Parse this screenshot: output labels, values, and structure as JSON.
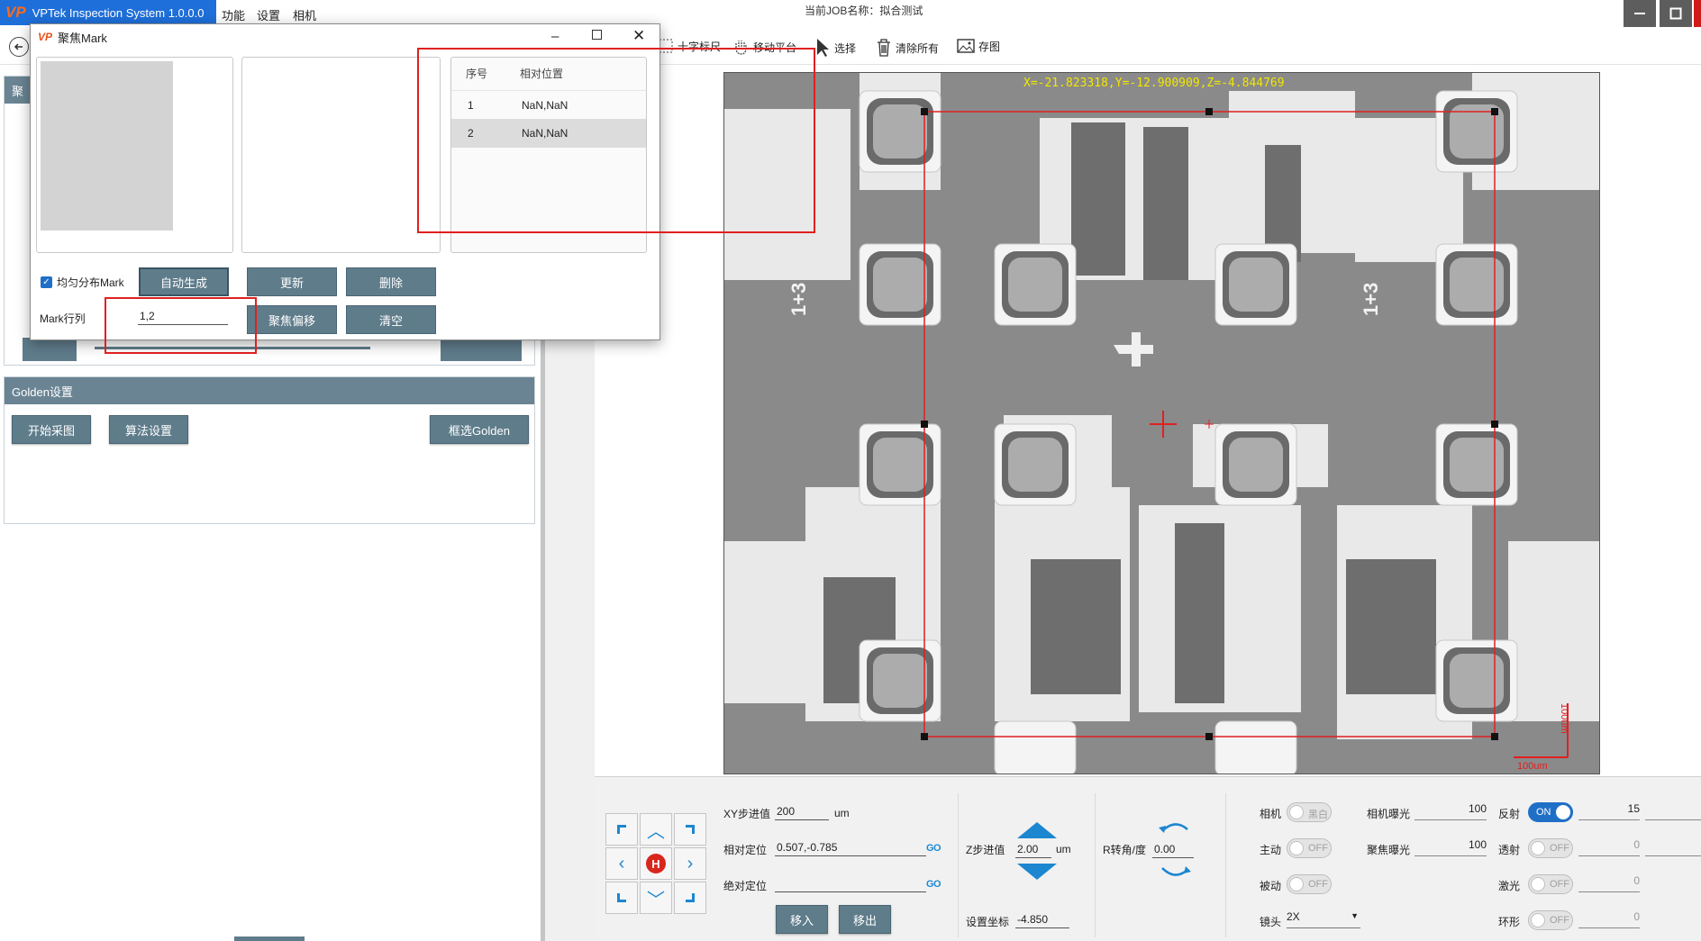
{
  "titlebar": {
    "app_title": "VPTek Inspection System 1.0.0.0",
    "logo": "VP",
    "menus": [
      "功能",
      "设置",
      "相机"
    ],
    "job_label": "当前JOB名称：拟合测试"
  },
  "toolbar": {
    "items": [
      {
        "label": "十字标尺",
        "icon": "crosshair-ruler-icon"
      },
      {
        "label": "移动平台",
        "icon": "hand-move-icon"
      },
      {
        "label": "选择",
        "icon": "cursor-select-icon"
      },
      {
        "label": "清除所有",
        "icon": "trash-icon"
      },
      {
        "label": "存图",
        "icon": "save-image-icon"
      }
    ]
  },
  "left_panel": {
    "section1_header": "聚",
    "golden": {
      "header": "Golden设置",
      "start_capture": "开始采图",
      "algo_settings": "算法设置",
      "select_golden": "框选Golden"
    }
  },
  "dialog": {
    "title": "聚焦Mark",
    "table": {
      "headers": [
        "序号",
        "相对位置"
      ],
      "rows": [
        {
          "index": "1",
          "position": "NaN,NaN"
        },
        {
          "index": "2",
          "position": "NaN,NaN"
        }
      ]
    },
    "checkbox_label": "均匀分布Mark",
    "checkbox_checked": true,
    "buttons": {
      "auto_generate": "自动生成",
      "update": "更新",
      "delete": "删除",
      "focus_offset": "聚焦偏移",
      "clear": "清空"
    },
    "mark_rowcol_label": "Mark行列",
    "mark_rowcol_value": "1,2"
  },
  "viewer": {
    "coords_text": "X=-21.823318,Y=-12.900909,Z=-4.844769",
    "scale_label_h": "100um",
    "scale_label_v": "100um"
  },
  "controls": {
    "xy_step_label": "XY步进值",
    "xy_step_value": "200",
    "xy_step_unit": "um",
    "rel_pos_label": "相对定位",
    "rel_pos_value": "0.507,-0.785",
    "abs_pos_label": "绝对定位",
    "abs_pos_value": "",
    "go_label": "GO",
    "move_in": "移入",
    "move_out": "移出",
    "z_step_label": "Z步进值",
    "z_step_value": "2.00",
    "z_step_unit": "um",
    "set_coord_label": "设置坐标",
    "set_coord_value": "-4.850",
    "r_angle_label": "R转角/度",
    "r_angle_value": "0.00",
    "camera_label": "相机",
    "camera_toggle": "黑白",
    "master_label": "主动",
    "master_toggle": "OFF",
    "slave_label": "被动",
    "slave_toggle": "OFF",
    "lens_label": "镜头",
    "lens_value": "2X",
    "cam_exposure_label": "相机曝光",
    "cam_exposure_value": "100",
    "focus_exposure_label": "聚焦曝光",
    "focus_exposure_value": "100",
    "reflect_label": "反射",
    "reflect_toggle": "ON",
    "reflect_value": "15",
    "transmit_label": "透射",
    "transmit_toggle": "OFF",
    "transmit_value": "0",
    "laser_label": "激光",
    "laser_toggle": "OFF",
    "laser_value": "0",
    "ring_label": "环形",
    "ring_toggle": "OFF",
    "ring_value": "0",
    "home_label": "H"
  },
  "colors": {
    "title_blue": "#1e6fd9",
    "button_slate": "#5f7c8b",
    "section_header": "#6a8493",
    "highlight_red": "#e02020",
    "coord_yellow": "#f2e600",
    "arrow_blue": "#1c86d0"
  }
}
